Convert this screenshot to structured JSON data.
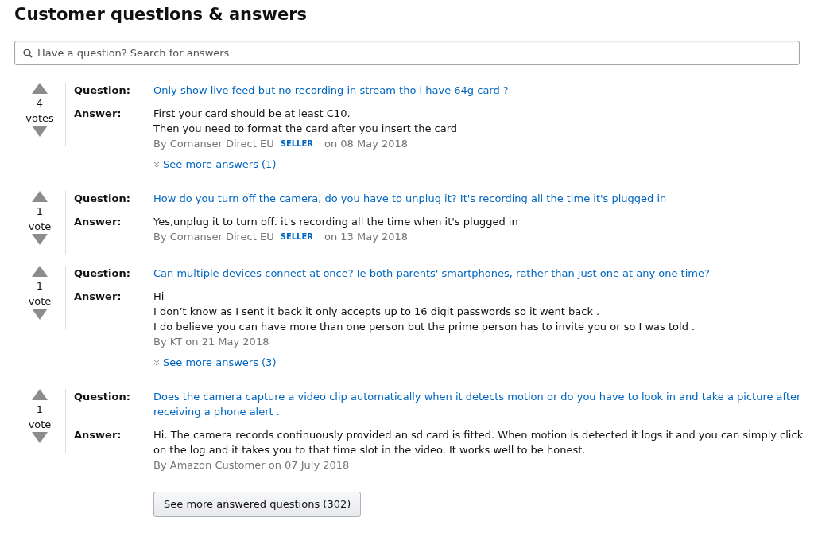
{
  "title": "Customer questions & answers",
  "search": {
    "placeholder": "Have a question? Search for answers"
  },
  "items": [
    {
      "count": "4",
      "unit": "votes",
      "question_label": "Question:",
      "question": "Only show live feed but no recording in stream tho i have 64g card ?",
      "answer_label": "Answer:",
      "answer": [
        "First your card should be at least C10.",
        "Then you need to format the card after you insert the card"
      ],
      "byline": "By Comanser Direct EU",
      "badge": "SELLER",
      "date": "on 08 May 2018",
      "more": "See more answers (1)"
    },
    {
      "count": "1",
      "unit": "vote",
      "question_label": "Question:",
      "question": "How do you turn off the camera, do you have to unplug it? It's recording all the time it's plugged in",
      "answer_label": "Answer:",
      "answer": [
        "Yes,unplug it to turn off. it's recording all the time when it's plugged in"
      ],
      "byline": "By Comanser Direct EU",
      "badge": "SELLER",
      "date": "on 13 May 2018"
    },
    {
      "count": "1",
      "unit": "vote",
      "question_label": "Question:",
      "question": "Can multiple devices connect at once? Ie both parents' smartphones, rather than just one at any one time?",
      "answer_label": "Answer:",
      "answer": [
        "Hi",
        "I don’t know as I sent it back it only accepts up to 16 digit passwords so it went back .",
        "I do believe you can have more than one person but the prime person has to invite you or so I was told ."
      ],
      "byline": "By KT on 21 May 2018",
      "more": "See more answers (3)"
    },
    {
      "count": "1",
      "unit": "vote",
      "question_label": "Question:",
      "question": "Does the camera capture a video clip automatically when it detects motion or do you have to look in and take a picture after receiving a phone alert .",
      "answer_label": "Answer:",
      "answer": [
        "Hi. The camera records continuously provided an sd card is fitted. When motion is detected it logs it and you can simply click on the log and it takes you to that time slot in the video. It works well to be honest."
      ],
      "byline": "By Amazon Customer on 07 July 2018"
    }
  ],
  "more_button": "See more answered questions (302)"
}
